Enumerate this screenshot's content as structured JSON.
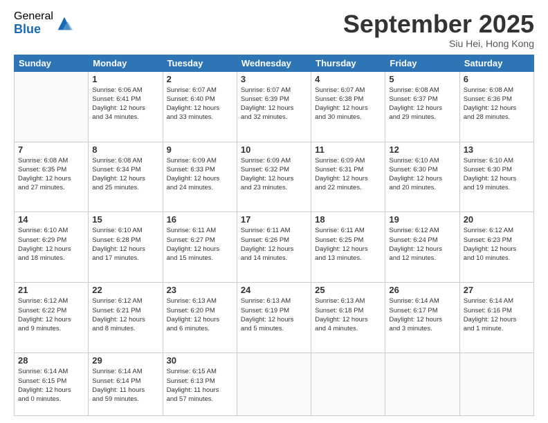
{
  "logo": {
    "general": "General",
    "blue": "Blue"
  },
  "header": {
    "month": "September 2025",
    "location": "Siu Hei, Hong Kong"
  },
  "weekdays": [
    "Sunday",
    "Monday",
    "Tuesday",
    "Wednesday",
    "Thursday",
    "Friday",
    "Saturday"
  ],
  "weeks": [
    [
      {
        "day": "",
        "info": ""
      },
      {
        "day": "1",
        "info": "Sunrise: 6:06 AM\nSunset: 6:41 PM\nDaylight: 12 hours\nand 34 minutes."
      },
      {
        "day": "2",
        "info": "Sunrise: 6:07 AM\nSunset: 6:40 PM\nDaylight: 12 hours\nand 33 minutes."
      },
      {
        "day": "3",
        "info": "Sunrise: 6:07 AM\nSunset: 6:39 PM\nDaylight: 12 hours\nand 32 minutes."
      },
      {
        "day": "4",
        "info": "Sunrise: 6:07 AM\nSunset: 6:38 PM\nDaylight: 12 hours\nand 30 minutes."
      },
      {
        "day": "5",
        "info": "Sunrise: 6:08 AM\nSunset: 6:37 PM\nDaylight: 12 hours\nand 29 minutes."
      },
      {
        "day": "6",
        "info": "Sunrise: 6:08 AM\nSunset: 6:36 PM\nDaylight: 12 hours\nand 28 minutes."
      }
    ],
    [
      {
        "day": "7",
        "info": "Sunrise: 6:08 AM\nSunset: 6:35 PM\nDaylight: 12 hours\nand 27 minutes."
      },
      {
        "day": "8",
        "info": "Sunrise: 6:08 AM\nSunset: 6:34 PM\nDaylight: 12 hours\nand 25 minutes."
      },
      {
        "day": "9",
        "info": "Sunrise: 6:09 AM\nSunset: 6:33 PM\nDaylight: 12 hours\nand 24 minutes."
      },
      {
        "day": "10",
        "info": "Sunrise: 6:09 AM\nSunset: 6:32 PM\nDaylight: 12 hours\nand 23 minutes."
      },
      {
        "day": "11",
        "info": "Sunrise: 6:09 AM\nSunset: 6:31 PM\nDaylight: 12 hours\nand 22 minutes."
      },
      {
        "day": "12",
        "info": "Sunrise: 6:10 AM\nSunset: 6:30 PM\nDaylight: 12 hours\nand 20 minutes."
      },
      {
        "day": "13",
        "info": "Sunrise: 6:10 AM\nSunset: 6:30 PM\nDaylight: 12 hours\nand 19 minutes."
      }
    ],
    [
      {
        "day": "14",
        "info": "Sunrise: 6:10 AM\nSunset: 6:29 PM\nDaylight: 12 hours\nand 18 minutes."
      },
      {
        "day": "15",
        "info": "Sunrise: 6:10 AM\nSunset: 6:28 PM\nDaylight: 12 hours\nand 17 minutes."
      },
      {
        "day": "16",
        "info": "Sunrise: 6:11 AM\nSunset: 6:27 PM\nDaylight: 12 hours\nand 15 minutes."
      },
      {
        "day": "17",
        "info": "Sunrise: 6:11 AM\nSunset: 6:26 PM\nDaylight: 12 hours\nand 14 minutes."
      },
      {
        "day": "18",
        "info": "Sunrise: 6:11 AM\nSunset: 6:25 PM\nDaylight: 12 hours\nand 13 minutes."
      },
      {
        "day": "19",
        "info": "Sunrise: 6:12 AM\nSunset: 6:24 PM\nDaylight: 12 hours\nand 12 minutes."
      },
      {
        "day": "20",
        "info": "Sunrise: 6:12 AM\nSunset: 6:23 PM\nDaylight: 12 hours\nand 10 minutes."
      }
    ],
    [
      {
        "day": "21",
        "info": "Sunrise: 6:12 AM\nSunset: 6:22 PM\nDaylight: 12 hours\nand 9 minutes."
      },
      {
        "day": "22",
        "info": "Sunrise: 6:12 AM\nSunset: 6:21 PM\nDaylight: 12 hours\nand 8 minutes."
      },
      {
        "day": "23",
        "info": "Sunrise: 6:13 AM\nSunset: 6:20 PM\nDaylight: 12 hours\nand 6 minutes."
      },
      {
        "day": "24",
        "info": "Sunrise: 6:13 AM\nSunset: 6:19 PM\nDaylight: 12 hours\nand 5 minutes."
      },
      {
        "day": "25",
        "info": "Sunrise: 6:13 AM\nSunset: 6:18 PM\nDaylight: 12 hours\nand 4 minutes."
      },
      {
        "day": "26",
        "info": "Sunrise: 6:14 AM\nSunset: 6:17 PM\nDaylight: 12 hours\nand 3 minutes."
      },
      {
        "day": "27",
        "info": "Sunrise: 6:14 AM\nSunset: 6:16 PM\nDaylight: 12 hours\nand 1 minute."
      }
    ],
    [
      {
        "day": "28",
        "info": "Sunrise: 6:14 AM\nSunset: 6:15 PM\nDaylight: 12 hours\nand 0 minutes."
      },
      {
        "day": "29",
        "info": "Sunrise: 6:14 AM\nSunset: 6:14 PM\nDaylight: 11 hours\nand 59 minutes."
      },
      {
        "day": "30",
        "info": "Sunrise: 6:15 AM\nSunset: 6:13 PM\nDaylight: 11 hours\nand 57 minutes."
      },
      {
        "day": "",
        "info": ""
      },
      {
        "day": "",
        "info": ""
      },
      {
        "day": "",
        "info": ""
      },
      {
        "day": "",
        "info": ""
      }
    ]
  ]
}
